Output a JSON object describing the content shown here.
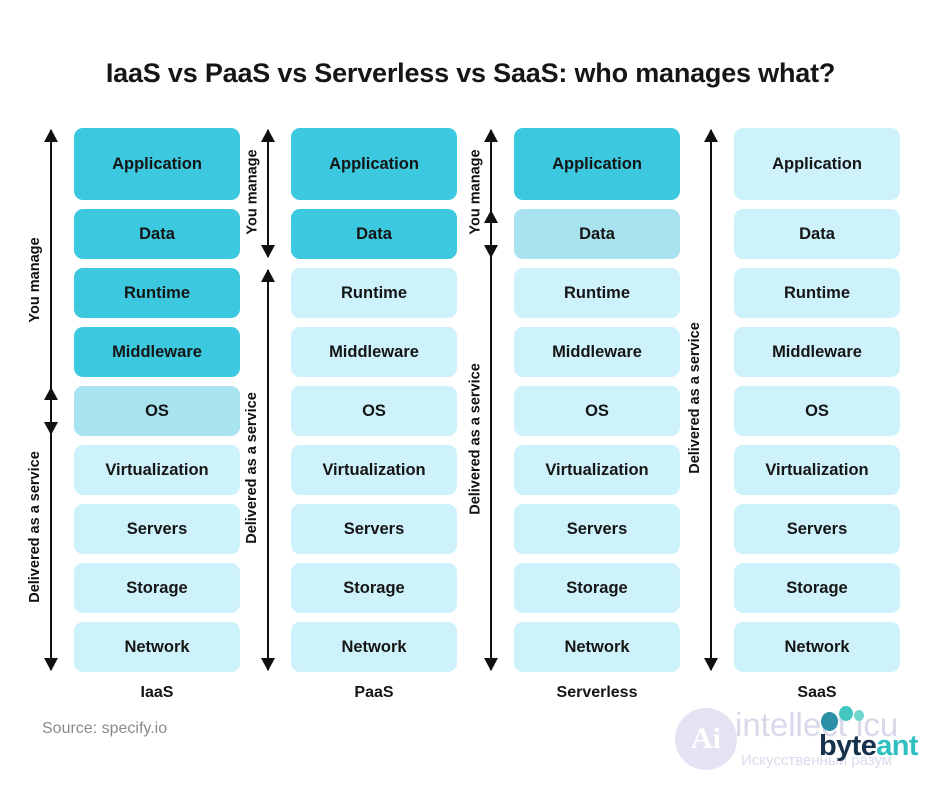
{
  "title": "IaaS vs PaaS vs Serverless vs SaaS: who manages what?",
  "layers": [
    "Application",
    "Data",
    "Runtime",
    "Middleware",
    "OS",
    "Virtualization",
    "Servers",
    "Storage",
    "Network"
  ],
  "labels": {
    "you_manage": "You manage",
    "delivered": "Delivered as a service"
  },
  "colors": {
    "dark": "#3CC8DF",
    "mid": "#A9E3EF",
    "light": "#CDF2FB",
    "text": "#151515",
    "arrow": "#111111",
    "source_text": "#8a8a8a"
  },
  "columns": [
    {
      "name": "IaaS",
      "tones": [
        "dark",
        "dark",
        "dark",
        "dark",
        "mid",
        "light",
        "light",
        "light",
        "light"
      ],
      "arrows": [
        {
          "label": "You manage",
          "heads": "both",
          "from_layer": 0,
          "to_layer": 4
        },
        {
          "label": "Delivered as a service",
          "heads": "both",
          "from_layer": 4,
          "to_layer": 8
        }
      ]
    },
    {
      "name": "PaaS",
      "tones": [
        "dark",
        "dark",
        "light",
        "light",
        "light",
        "light",
        "light",
        "light",
        "light"
      ],
      "arrows": [
        {
          "label": "You manage",
          "heads": "both",
          "from_layer": 0,
          "to_layer": 1
        },
        {
          "label": "Delivered as a service",
          "heads": "both",
          "from_layer": 2,
          "to_layer": 8
        }
      ]
    },
    {
      "name": "Serverless",
      "tones": [
        "dark",
        "mid",
        "light",
        "light",
        "light",
        "light",
        "light",
        "light",
        "light"
      ],
      "arrows": [
        {
          "label": "You manage",
          "heads": "both",
          "from_layer": 0,
          "to_layer": 1
        },
        {
          "label": "Delivered as a service",
          "heads": "both",
          "from_layer": 1,
          "to_layer": 8
        }
      ]
    },
    {
      "name": "SaaS",
      "tones": [
        "light",
        "light",
        "light",
        "light",
        "light",
        "light",
        "light",
        "light",
        "light"
      ],
      "arrows": [
        {
          "label": "Delivered as a service",
          "heads": "both",
          "from_layer": 0,
          "to_layer": 8
        }
      ]
    }
  ],
  "footer": {
    "source": "Source: specify.io"
  },
  "watermark": {
    "badge": "Ai",
    "brand": "intellect icu",
    "tagline": "Искусственный разум",
    "logo_first": "byte",
    "logo_second": "ant"
  }
}
